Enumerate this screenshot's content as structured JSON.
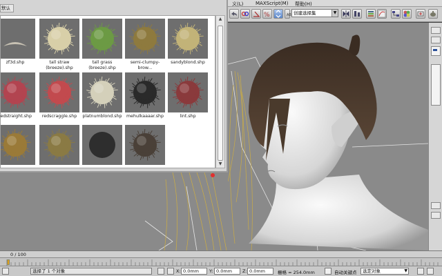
{
  "browser": {
    "tab_label": "默认",
    "materials": [
      {
        "label": "zf3d.shp",
        "kind": "wisp",
        "color": "#ddd6c4"
      },
      {
        "label": "tall straw (breeze).shp",
        "kind": "fluffy",
        "color": "#d8cfa8"
      },
      {
        "label": "tall grass (breeze).shp",
        "kind": "fluffy",
        "color": "#6c9a44"
      },
      {
        "label": "semi-clumpy-brow...",
        "kind": "fluffy",
        "color": "#8e7a3e"
      },
      {
        "label": "sandyblond.shp",
        "kind": "fluffy",
        "color": "#c2b378"
      },
      {
        "label": "redstraight.shp",
        "kind": "fluffy",
        "color": "#b24450"
      },
      {
        "label": "redscraggle.shp",
        "kind": "fluffy",
        "color": "#c24a4e"
      },
      {
        "label": "platnumblond.shp",
        "kind": "fluffy",
        "color": "#d4d0ba"
      },
      {
        "label": "mehulkaaaar.shp",
        "kind": "fluffy",
        "color": "#2a2a2a"
      },
      {
        "label": "lint.shp",
        "kind": "fluffy",
        "color": "#8a3a3c"
      },
      {
        "label": "",
        "kind": "fluffy",
        "color": "#9a7a38"
      },
      {
        "label": "",
        "kind": "fluffy",
        "color": "#8a7a44"
      },
      {
        "label": "",
        "kind": "smooth",
        "color": "#2e2e2e"
      },
      {
        "label": "",
        "kind": "fluffy",
        "color": "#4a4038"
      }
    ]
  },
  "menubar": {
    "items": [
      "义(L)",
      "MAXScript(M)",
      "帮助(H)"
    ]
  },
  "toolbar": {
    "selection_set": "创建选择集"
  },
  "timeline": {
    "frame": "0 / 100"
  },
  "statusbar": {
    "message": "选择了 1 个对象",
    "x_label": "X:",
    "x_value": "0.0mm",
    "y_label": "Y:",
    "y_value": "0.0mm",
    "z_label": "Z:",
    "z_value": "0.0mm",
    "grid": "栅格 = 254.0mm",
    "autokey": "自动关键点",
    "selected_object": "选定对象"
  },
  "colors": {
    "panel": "#d4d4d4",
    "viewport": "#8a8a8a",
    "accent_blue": "#2a4f9a"
  }
}
